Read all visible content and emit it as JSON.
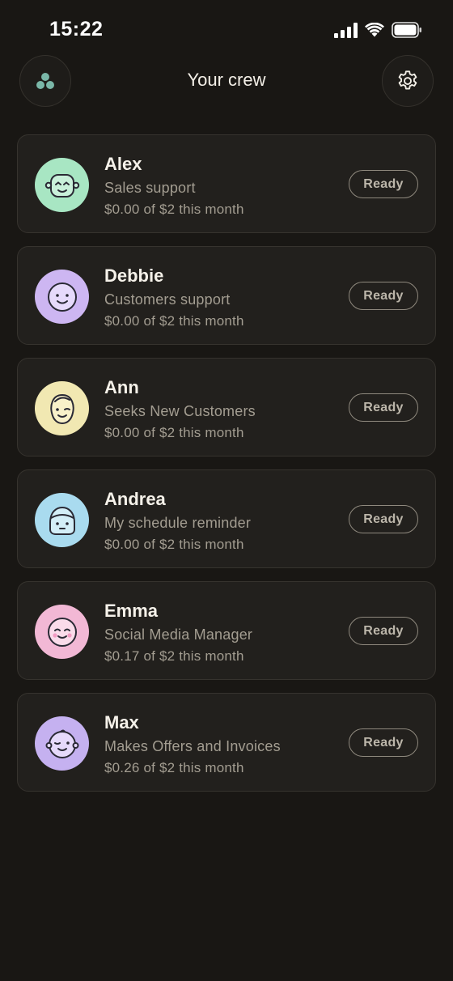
{
  "status_bar": {
    "time": "15:22"
  },
  "header": {
    "title": "Your crew",
    "left_button_icon": "crew-dots-icon",
    "right_button_icon": "gear-icon"
  },
  "crew": [
    {
      "name": "Alex",
      "role": "Sales support",
      "usage": "$0.00 of $2 this month",
      "status": "Ready",
      "avatar_color": "#a8e6c3",
      "avatar_icon": "robot-face-icon"
    },
    {
      "name": "Debbie",
      "role": "Customers support",
      "usage": "$0.00 of $2 this month",
      "status": "Ready",
      "avatar_color": "#cdb6f2",
      "avatar_icon": "smiling-face-icon"
    },
    {
      "name": "Ann",
      "role": "Seeks New Customers",
      "usage": "$0.00 of $2 this month",
      "status": "Ready",
      "avatar_color": "#f1e8b2",
      "avatar_icon": "winking-face-icon"
    },
    {
      "name": "Andrea",
      "role": "My schedule reminder",
      "usage": "$0.00 of $2 this month",
      "status": "Ready",
      "avatar_color": "#a9dbef",
      "avatar_icon": "helmet-face-icon"
    },
    {
      "name": "Emma",
      "role": "Social Media Manager",
      "usage": "$0.17 of $2 this month",
      "status": "Ready",
      "avatar_color": "#f2b8d5",
      "avatar_icon": "blushing-face-icon"
    },
    {
      "name": "Max",
      "role": "Makes Offers and Invoices",
      "usage": "$0.26 of $2 this month",
      "status": "Ready",
      "avatar_color": "#c5b1f0",
      "avatar_icon": "winking-baby-face-icon"
    }
  ]
}
